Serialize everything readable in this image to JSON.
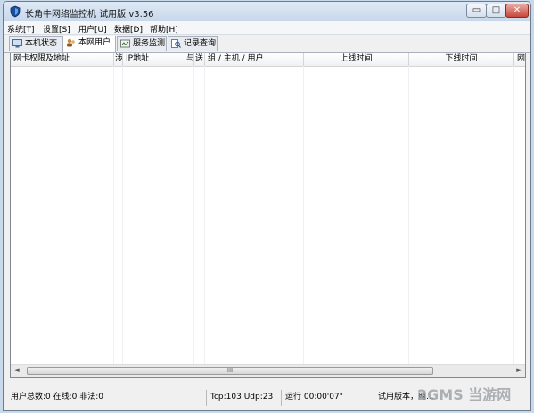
{
  "window": {
    "title": "长角牛网络监控机 试用版 v3.56",
    "controls": {
      "minimize": "▭",
      "maximize": "□",
      "close": "✕"
    }
  },
  "menu": [
    "系统[T]",
    "设置[S]",
    "用户[U]",
    "数据[D]",
    "帮助[H]"
  ],
  "tabs": [
    {
      "label": "本机状态",
      "icon": "monitor-icon"
    },
    {
      "label": "本网用户",
      "icon": "users-icon"
    },
    {
      "label": "服务监测",
      "icon": "service-icon"
    },
    {
      "label": "记录查询",
      "icon": "search-records-icon"
    }
  ],
  "table": {
    "columns": [
      "网卡权限及地址",
      "涉",
      "IP地址",
      "与",
      "送",
      "组 / 主机 / 用户",
      "上线时间",
      "下线时间",
      "网"
    ],
    "rows": []
  },
  "scrollbar": {
    "left_arrow": "◄",
    "right_arrow": "►",
    "thumb_grip": "III"
  },
  "status": {
    "users": "用户总数:0 在线:0 非法:0",
    "ports": "Tcp:103 Udp:23",
    "runtime": "运行 00:00'07\"",
    "version": "试用版本，网..."
  },
  "watermark": "2GMS 当游网",
  "colors": {
    "accent": "#1b4f9c",
    "close_button": "#c7463a"
  }
}
